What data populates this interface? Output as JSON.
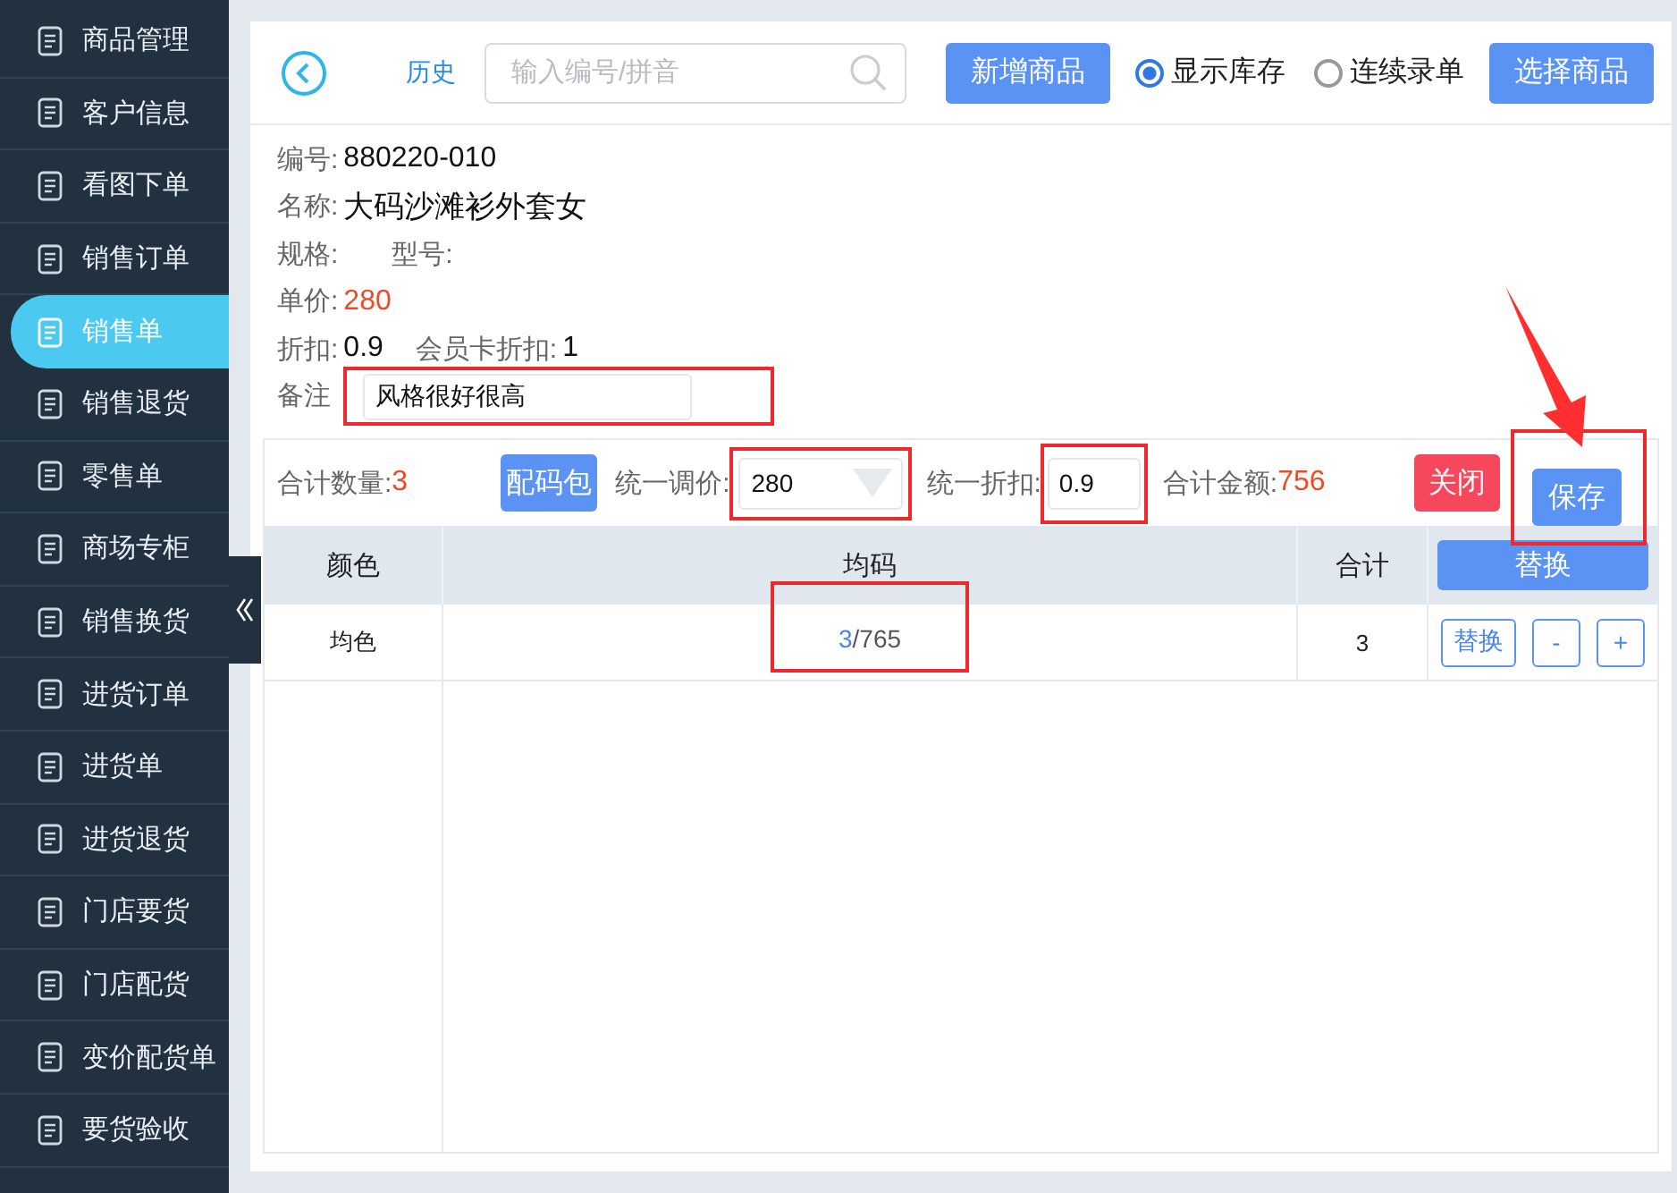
{
  "sidebar": {
    "items": [
      {
        "label": "商品管理",
        "selected": false
      },
      {
        "label": "客户信息",
        "selected": false
      },
      {
        "label": "看图下单",
        "selected": false
      },
      {
        "label": "销售订单",
        "selected": false
      },
      {
        "label": "销售单",
        "selected": true
      },
      {
        "label": "销售退货",
        "selected": false
      },
      {
        "label": "零售单",
        "selected": false
      },
      {
        "label": "商场专柜",
        "selected": false
      },
      {
        "label": "销售换货",
        "selected": false
      },
      {
        "label": "进货订单",
        "selected": false
      },
      {
        "label": "进货单",
        "selected": false
      },
      {
        "label": "进货退货",
        "selected": false
      },
      {
        "label": "门店要货",
        "selected": false
      },
      {
        "label": "门店配货",
        "selected": false
      },
      {
        "label": "变价配货单",
        "selected": false
      },
      {
        "label": "要货验收",
        "selected": false
      }
    ]
  },
  "toolbar": {
    "history": "历史",
    "search": {
      "placeholder": "输入编号/拼音"
    },
    "new_button": "新增商品",
    "options": [
      {
        "label": "显示库存",
        "checked": true
      },
      {
        "label": "连续录单",
        "checked": false
      }
    ],
    "select_button": "选择商品"
  },
  "product": {
    "code_label": "编号:",
    "code": "880220-010",
    "name_label": "名称:",
    "name": "大码沙滩衫外套女",
    "spec_label": "规格:",
    "model_label": "型号:",
    "price_label": "单价:",
    "price": "280",
    "discount_label": "折扣:",
    "discount": "0.9",
    "card_discount_label": "会员卡折扣:",
    "card_discount": "1",
    "note_label": "备注",
    "note": "风格很好很高"
  },
  "summary": {
    "qty_label": "合计数量:",
    "qty": "3",
    "size_pack": "配码包",
    "price_label": "统一调价:",
    "price": "280",
    "discount_label": "统一折扣:",
    "discount": "0.9",
    "amount_label": "合计金额:",
    "amount": "756",
    "close": "关闭",
    "save": "保存"
  },
  "table": {
    "columns": [
      "颜色",
      "均码",
      "合计"
    ],
    "header_button": "替换",
    "rows": [
      {
        "color_name": "均色",
        "qty": "3",
        "stock": "/765",
        "total": "3",
        "replace": "替换",
        "minus": "-",
        "plus": "+"
      }
    ]
  }
}
